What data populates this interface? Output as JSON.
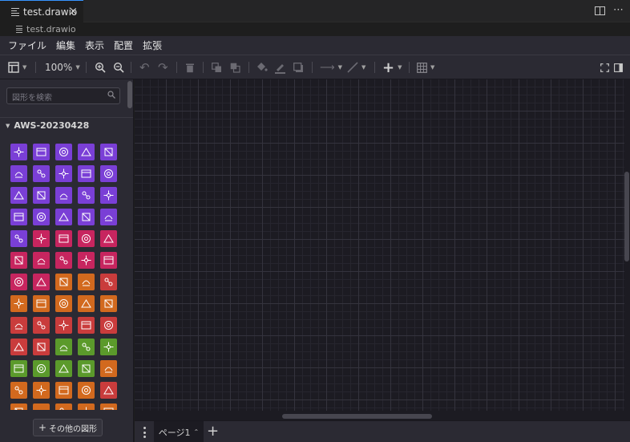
{
  "tab": {
    "title": "test.drawio",
    "close_icon": "×"
  },
  "breadcrumb": {
    "file": "test.drawio"
  },
  "menu": [
    "ファイル",
    "編集",
    "表示",
    "配置",
    "拡張"
  ],
  "toolbar": {
    "zoom": "100%"
  },
  "sidebar": {
    "search_placeholder": "図形を検索",
    "group_title": "AWS-20230428",
    "more_shapes": "その他の図形",
    "shape_colors": [
      "purple",
      "purple",
      "purple",
      "purple",
      "purple",
      "purple",
      "purple",
      "purple",
      "purple",
      "purple",
      "purple",
      "purple",
      "purple",
      "purple",
      "purple",
      "purple",
      "purple",
      "purple",
      "purple",
      "purple",
      "purple",
      "pink",
      "pink",
      "pink",
      "pink",
      "pink",
      "pink",
      "pink",
      "pink",
      "pink",
      "pink",
      "pink",
      "orange",
      "orange",
      "red",
      "orange",
      "orange",
      "orange",
      "orange",
      "orange",
      "red",
      "red",
      "red",
      "red",
      "red",
      "red",
      "red",
      "green",
      "green",
      "green",
      "green",
      "green",
      "green",
      "green",
      "orange",
      "orange",
      "orange",
      "orange",
      "orange",
      "red",
      "orange",
      "orange",
      "orange",
      "orange",
      "orange"
    ]
  },
  "pagebar": {
    "page_label": "ページ1"
  },
  "colors": {
    "purple": "#7a3fd6",
    "pink": "#c7255f",
    "orange": "#d2691e",
    "green": "#5b9a2b",
    "red": "#c93c3c",
    "accent": "#3794ff"
  }
}
